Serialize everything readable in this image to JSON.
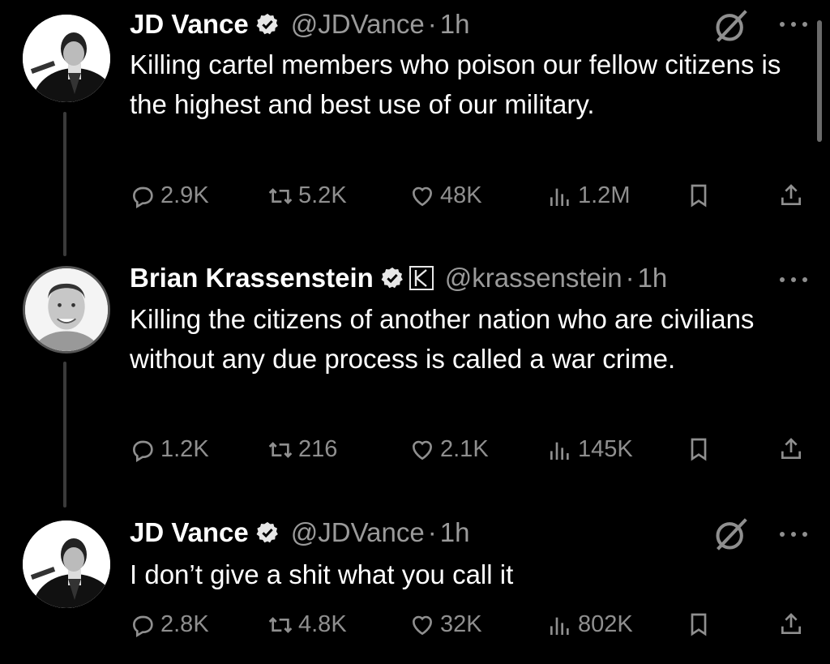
{
  "tweets": [
    {
      "author": "JD Vance",
      "handle": "@JDVance",
      "separator": "·",
      "time": "1h",
      "text": "Killing cartel members who poison our fellow citizens is the highest and best use of our military.",
      "stats": {
        "replies": "2.9K",
        "reposts": "5.2K",
        "likes": "48K",
        "views": "1.2M"
      }
    },
    {
      "author": "Brian Krassenstein",
      "handle": "@krassenstein",
      "separator": "·",
      "time": "1h",
      "text": "Killing the citizens of another nation who are civilians without any due process is called a war crime.",
      "stats": {
        "replies": "1.2K",
        "reposts": "216",
        "likes": "2.1K",
        "views": "145K"
      }
    },
    {
      "author": "JD Vance",
      "handle": "@JDVance",
      "separator": "·",
      "time": "1h",
      "text": "I don’t give a shit what you call it",
      "stats": {
        "replies": "2.8K",
        "reposts": "4.8K",
        "likes": "32K",
        "views": "802K"
      }
    }
  ],
  "icons": {
    "verified": "verified-badge-icon",
    "affiliate": "k-affiliate-icon",
    "grok": "grok-icon",
    "more": "more-icon",
    "reply": "reply-icon",
    "repost": "repost-icon",
    "like": "heart-icon",
    "views": "views-icon",
    "bookmark": "bookmark-icon",
    "share": "share-icon"
  }
}
